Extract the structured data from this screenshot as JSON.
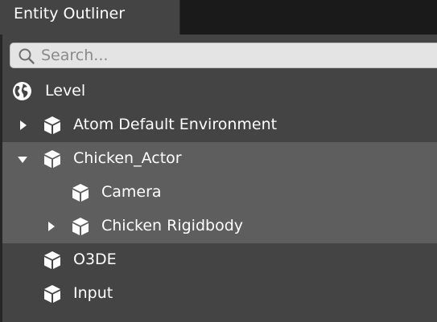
{
  "panel": {
    "title": "Entity Outliner"
  },
  "search": {
    "placeholder": "Search..."
  },
  "tree": {
    "items": [
      {
        "label": "Level",
        "icon": "globe-icon",
        "expander": "none"
      },
      {
        "label": "Atom Default Environment",
        "icon": "entity-cube-icon",
        "expander": "collapsed"
      },
      {
        "label": "Chicken_Actor",
        "icon": "entity-cube-icon",
        "expander": "expanded"
      },
      {
        "label": "Camera",
        "icon": "entity-cube-icon",
        "expander": "none"
      },
      {
        "label": "Chicken Rigidbody",
        "icon": "entity-cube-icon",
        "expander": "collapsed"
      },
      {
        "label": "O3DE",
        "icon": "entity-cube-icon",
        "expander": "none"
      },
      {
        "label": "Input",
        "icon": "entity-cube-icon",
        "expander": "none"
      }
    ]
  },
  "colors": {
    "panel_background": "#444444",
    "selection_background": "#5e5e5e",
    "tab_strip_background": "#1a1a1a",
    "text": "#ffffff"
  }
}
